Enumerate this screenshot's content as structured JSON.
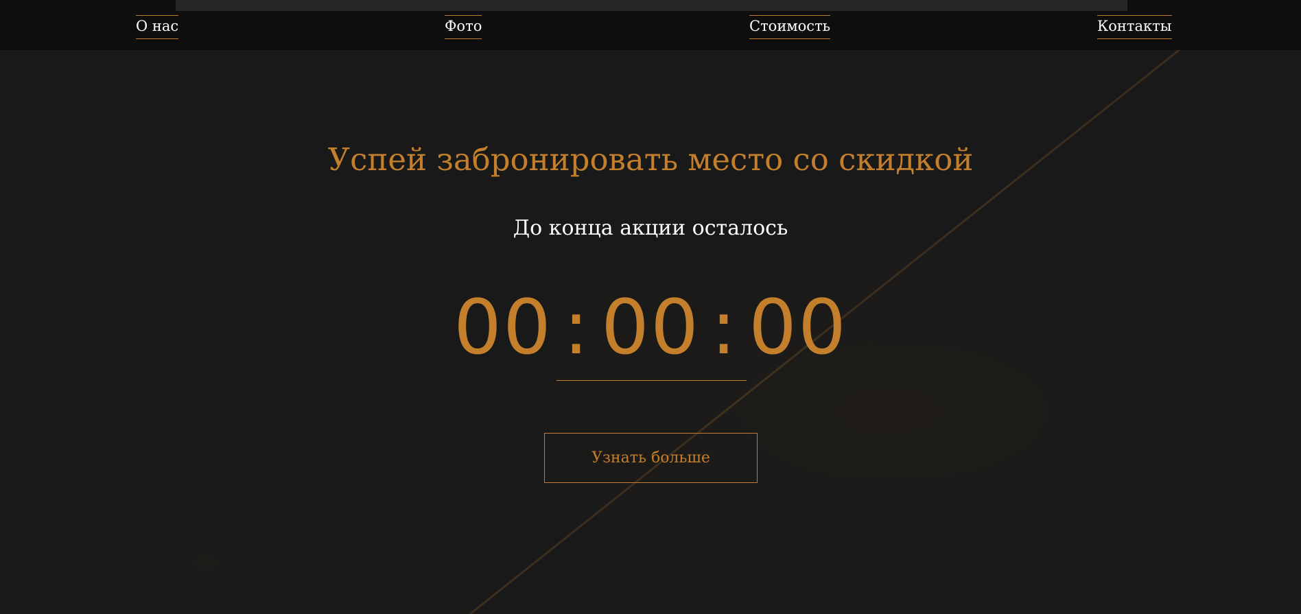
{
  "nav": {
    "items": [
      {
        "label": "О нас"
      },
      {
        "label": "Фото"
      },
      {
        "label": "Стоимость"
      },
      {
        "label": "Контакты"
      }
    ]
  },
  "promo": {
    "title": "Успей забронировать место со скидкой",
    "subtitle": "До конца акции осталось",
    "timer": {
      "hours": "00",
      "minutes": "00",
      "seconds": "00",
      "separator": ":"
    },
    "cta_label": "Узнать больше"
  },
  "colors": {
    "accent": "#c47f2c",
    "background": "#191919",
    "nav_background": "#0e0e0e",
    "text": "#ffffff"
  }
}
